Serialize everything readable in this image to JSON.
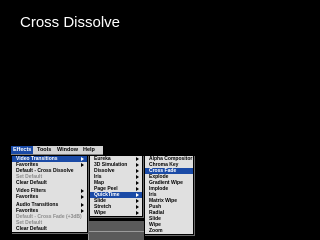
{
  "slide": {
    "title": "Cross Dissolve"
  },
  "menubar": {
    "items": [
      "Effects",
      "Tools",
      "Window",
      "Help"
    ]
  },
  "effects_menu": {
    "items": [
      {
        "label": "Video Transitions",
        "highlighted": true,
        "submenu": true
      },
      {
        "label": "Favorites",
        "submenu": true
      },
      {
        "label": "Default - Cross Dissolve"
      },
      {
        "label": "Set Default",
        "disabled": true
      },
      {
        "label": "Clear Default"
      },
      {
        "label": "Video Filters",
        "submenu": true
      },
      {
        "label": "Favorites",
        "submenu": true
      },
      {
        "label": "Audio Transitions",
        "submenu": true
      },
      {
        "label": "Favorites",
        "submenu": true
      },
      {
        "label": "Default - Cross Fade (+3dB)",
        "disabled": true
      },
      {
        "label": "Set Default",
        "disabled": true
      },
      {
        "label": "Clear Default"
      }
    ]
  },
  "categories_menu": {
    "items": [
      {
        "label": "Eureka",
        "submenu": true
      },
      {
        "label": "3D Simulation",
        "submenu": true
      },
      {
        "label": "Dissolve",
        "submenu": true
      },
      {
        "label": "Iris",
        "submenu": true
      },
      {
        "label": "Map",
        "submenu": true
      },
      {
        "label": "Page Peel",
        "submenu": true
      },
      {
        "label": "QuickTime",
        "highlighted": true,
        "submenu": true
      },
      {
        "label": "Slide",
        "submenu": true
      },
      {
        "label": "Stretch",
        "submenu": true
      },
      {
        "label": "Wipe",
        "submenu": true
      }
    ]
  },
  "quicktime_menu": {
    "items": [
      {
        "label": "Alpha Compositor"
      },
      {
        "label": "Chroma Key"
      },
      {
        "label": "Cross Fade",
        "highlighted": true
      },
      {
        "label": "Explode"
      },
      {
        "label": "Gradient Wipe"
      },
      {
        "label": "Implode"
      },
      {
        "label": "Iris"
      },
      {
        "label": "Matrix Wipe"
      },
      {
        "label": "Push"
      },
      {
        "label": "Radial"
      },
      {
        "label": "Slide"
      },
      {
        "label": "Wipe"
      },
      {
        "label": "Zoom"
      }
    ]
  },
  "colors": {
    "highlight": "#1a4aa6",
    "menu_bg": "#e0e0e0",
    "disabled_text": "#8c8c8c",
    "slide_bg": "#000000"
  }
}
